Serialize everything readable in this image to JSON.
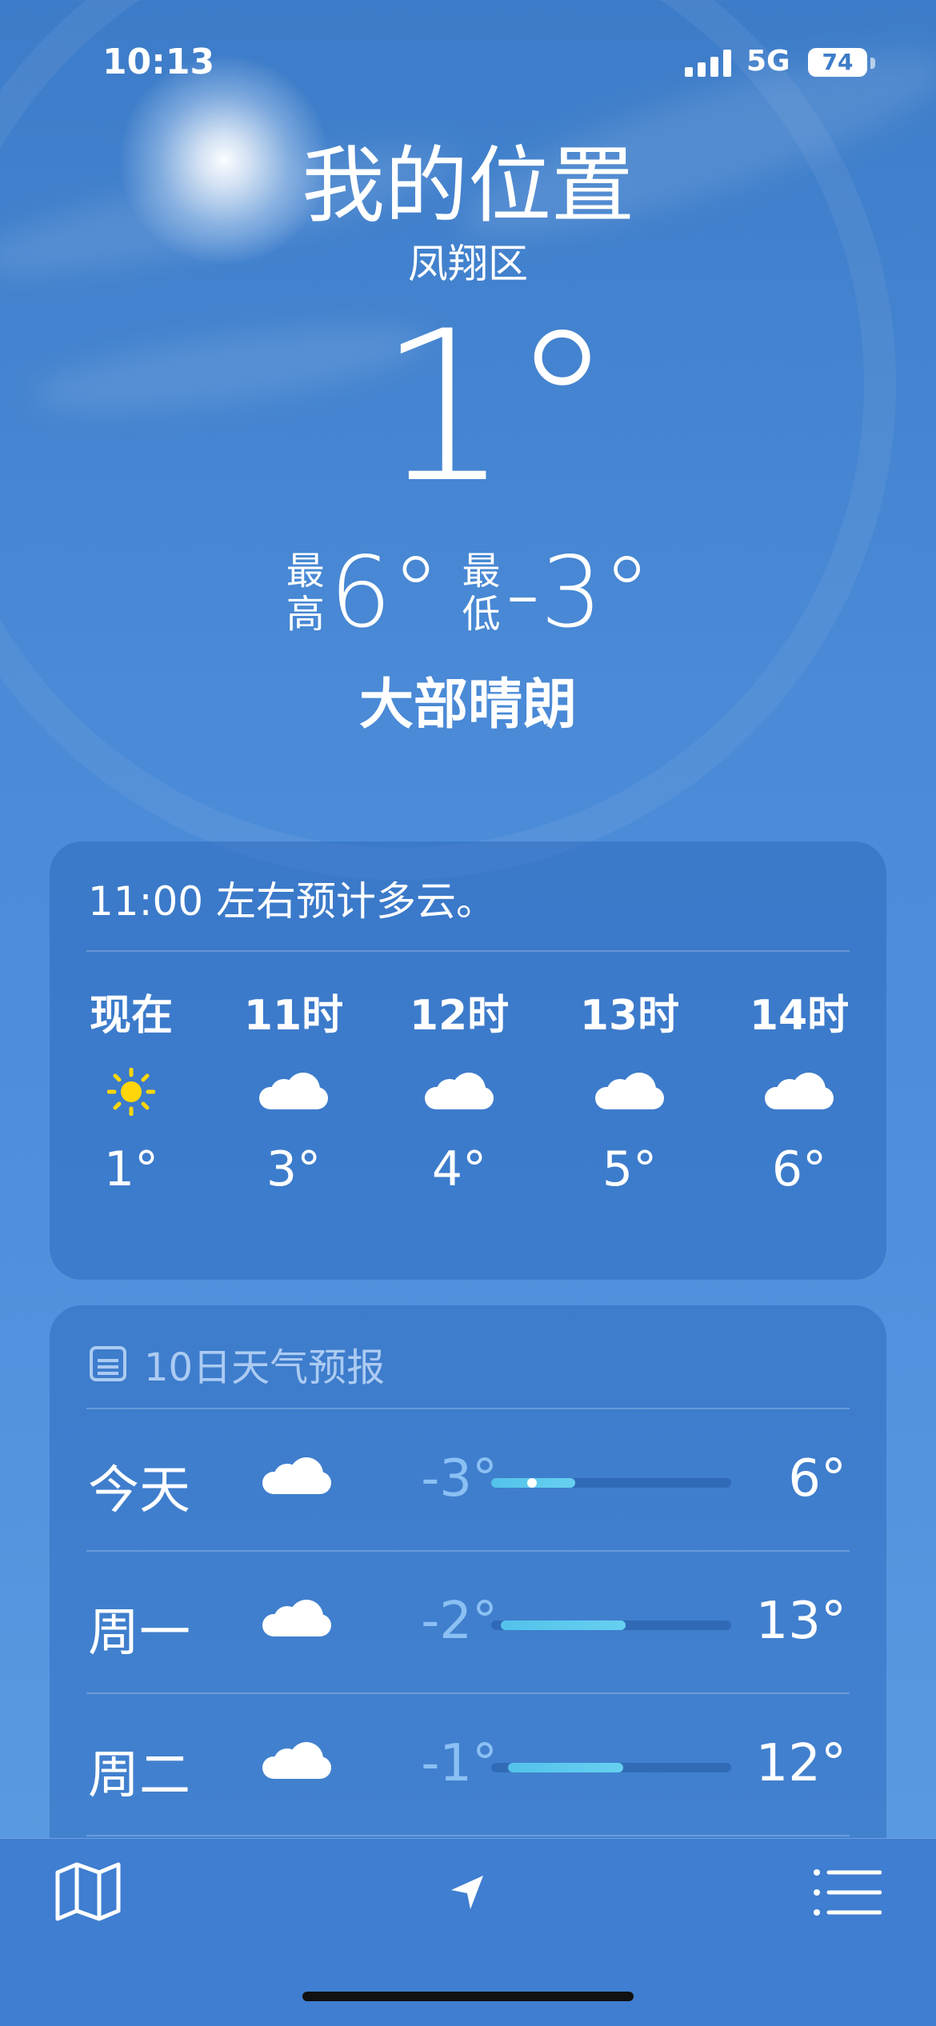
{
  "status_bar": {
    "time": "10:13",
    "network": "5G",
    "battery": "74"
  },
  "location": {
    "title": "我的位置",
    "subtitle": "凤翔区"
  },
  "current": {
    "temperature": "1°",
    "high_label": "最高",
    "high": "6°",
    "low_label": "最低",
    "low": "-3°",
    "condition": "大部晴朗"
  },
  "hourly": {
    "summary": "11:00 左右预计多云。",
    "items": [
      {
        "label": "现在",
        "icon": "sun-icon",
        "temp": "1°"
      },
      {
        "label": "11时",
        "icon": "cloud-icon",
        "temp": "3°"
      },
      {
        "label": "12时",
        "icon": "cloud-icon",
        "temp": "4°"
      },
      {
        "label": "13时",
        "icon": "cloud-icon",
        "temp": "5°"
      },
      {
        "label": "14时",
        "icon": "cloud-icon",
        "temp": "6°"
      }
    ]
  },
  "forecast": {
    "title": "10日天气预报",
    "title_icon": "calendar-icon",
    "days": [
      {
        "name": "今天",
        "icon": "cloud-icon",
        "low": "-3°",
        "high": "6°",
        "range_start": 0.0,
        "range_end": 0.35,
        "current_marker": 0.17
      },
      {
        "name": "周一",
        "icon": "cloud-icon",
        "low": "-2°",
        "high": "13°",
        "range_start": 0.04,
        "range_end": 0.56
      },
      {
        "name": "周二",
        "icon": "cloud-icon",
        "low": "-1°",
        "high": "12°",
        "range_start": 0.07,
        "range_end": 0.55
      }
    ]
  },
  "tab_bar": {
    "left_icon": "map-icon",
    "center_icon": "location-arrow-icon",
    "right_icon": "list-icon"
  },
  "colors": {
    "sky_top": "#3d7cc8",
    "sky_bottom": "#5b9ce2",
    "sun_yellow": "#ffd60a",
    "range_fill": "#5ac8ec",
    "low_temp": "#a0d2ff"
  }
}
